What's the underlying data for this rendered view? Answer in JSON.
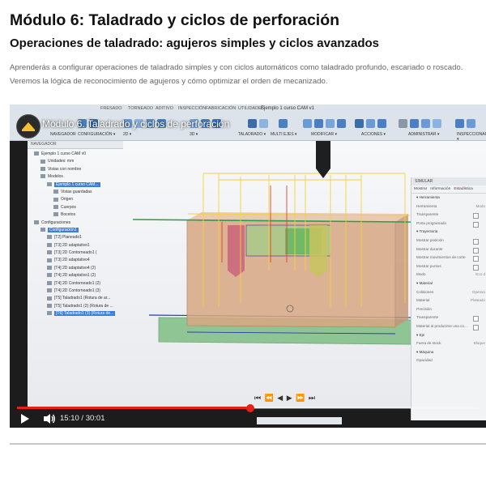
{
  "page": {
    "title": "Módulo 6: Taladrado y ciclos de perforación",
    "subtitle": "Operaciones de taladrado: agujeros simples y ciclos avanzados",
    "description": "Aprenderás a configurar operaciones de taladrado simples y con ciclos automáticos como taladrado profundo, escariado o roscado. Veremos la lógica de reconocimiento de agujeros y cómo optimizar el orden de mecanizado."
  },
  "video": {
    "title": "Módulo 6. Taladrado y ciclos de perforación",
    "time_current": "15:10",
    "time_total": "30:01",
    "progress_fraction": 0.505,
    "accent": "#e62117"
  },
  "cad": {
    "file_title": "Ejemplo 1 curso CAM v1",
    "menu_tabs": [
      "FRESADO",
      "TORNEADO",
      "ADITIVO",
      "INSPECCIÓN",
      "FABRICACIÓN",
      "UTILIDADES"
    ],
    "toolbar_groups": [
      "NAVEGADOR",
      "CONFIGURACIÓN ▾",
      "2D ▾",
      "3D ▾",
      "TALADRADO ▾",
      "MULTI EJES ▾",
      "MODIFICAR ▾",
      "ACCIONES ▾",
      "ADMINISTRAR ▾",
      "INSPECCIONAR ▾"
    ],
    "browser": {
      "header": "NAVEGADOR",
      "items": [
        "Ejemplo 1 curso CAM v0",
        "Unidades: mm",
        "Vistas con nombre",
        "Modelos",
        "Ejemplo 1 curso CAM...",
        "Vistas guardadas",
        "Origen",
        "Cuerpos",
        "Bocetos",
        "Configuraciones",
        "Configuración1",
        "[T2] Planeado1",
        "[T3] 2D adaptativo1",
        "[T3] 2D Contorneado1 (",
        "[T3] 2D adaptativo4",
        "[T4] 2D adaptativo4 (2)",
        "[T4] 2D adaptativo1 (2)",
        "[T4] 2D Contorneado1 (2)",
        "[T4] 2D Contorneado1 (3)",
        "[T5] Taladrado1 (Rotura de ar...",
        "[T5] Taladrado1 (2) (Rotura de ...",
        "[T6] Taladrado1 (3) (Rotura de..."
      ]
    },
    "simulation": {
      "header": "SIMULAR",
      "tabs": [
        "Mostrar",
        "Información",
        "Estadística"
      ],
      "rows": [
        {
          "label": "Herramienta",
          "section": true
        },
        {
          "label": "Herramienta",
          "value": "Modo"
        },
        {
          "label": "Transparente",
          "box": true
        },
        {
          "label": "Porta programado",
          "box": true
        },
        {
          "label": "Trayectoria",
          "section": true
        },
        {
          "label": "Mostrar posición",
          "box": true
        },
        {
          "label": "Mostrar durante",
          "box": true
        },
        {
          "label": "Mostrar movimientos de corte",
          "box": true
        },
        {
          "label": "Mostrar puntos",
          "box": true
        },
        {
          "label": "Modo",
          "value": "Eco d"
        },
        {
          "label": "Material",
          "section": true
        },
        {
          "label": "Colisiones",
          "value": "Operaci"
        },
        {
          "label": "Material",
          "value": "Plateado"
        },
        {
          "label": "Precisión",
          "value": ""
        },
        {
          "label": "Transparente",
          "box": true
        },
        {
          "label": "Material al producirse una co...",
          "box": true
        },
        {
          "label": "Eje",
          "section": true
        },
        {
          "label": "Fuera de stock",
          "value": "Bloque"
        },
        {
          "label": "Máquina",
          "section": true
        },
        {
          "label": "Opacidad",
          "value": ""
        }
      ]
    }
  }
}
